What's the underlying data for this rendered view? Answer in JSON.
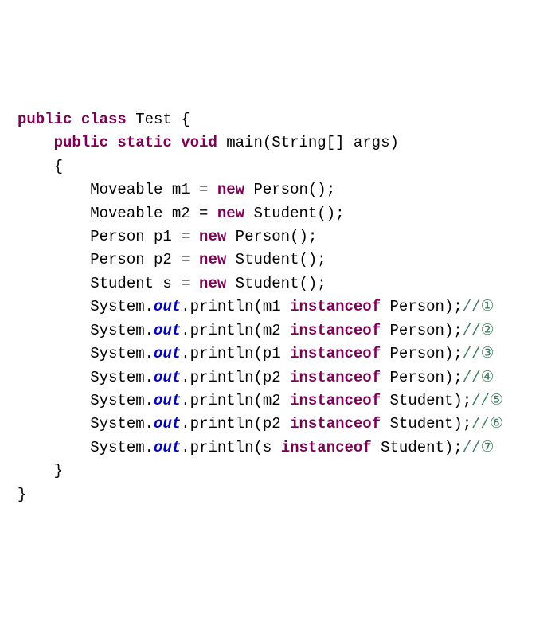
{
  "code": {
    "line1": {
      "kw1": "public class",
      "rest": " Test {"
    },
    "line2": {
      "indent": "    ",
      "kw1": "public static void",
      "rest": " main(String[] args)"
    },
    "line3": {
      "indent": "    ",
      "rest": "{"
    },
    "line4": {
      "indent": "        ",
      "part1": "Moveable m1 = ",
      "kw": "new",
      "part2": " Person();"
    },
    "line5": {
      "indent": "        ",
      "part1": "Moveable m2 = ",
      "kw": "new",
      "part2": " Student();"
    },
    "line6": {
      "indent": "        ",
      "part1": "Person p1 = ",
      "kw": "new",
      "part2": " Person();"
    },
    "line7": {
      "indent": "        ",
      "part1": "Person p2 = ",
      "kw": "new",
      "part2": " Student();"
    },
    "line8": {
      "indent": "        ",
      "part1": "Student s = ",
      "kw": "new",
      "part2": " Student();"
    },
    "line9": {
      "indent": "        ",
      "sys": "System.",
      "out": "out",
      "print": ".println(m1 ",
      "kw": "instanceof",
      "rest": " Person);",
      "comment": "//①"
    },
    "line10": {
      "indent": "        ",
      "sys": "System.",
      "out": "out",
      "print": ".println(m2 ",
      "kw": "instanceof",
      "rest": " Person);",
      "comment": "//②"
    },
    "line11": {
      "indent": "        ",
      "sys": "System.",
      "out": "out",
      "print": ".println(p1 ",
      "kw": "instanceof",
      "rest": " Person);",
      "comment": "//③"
    },
    "line12": {
      "indent": "        ",
      "sys": "System.",
      "out": "out",
      "print": ".println(p2 ",
      "kw": "instanceof",
      "rest": " Person);",
      "comment": "//④"
    },
    "line13": {
      "indent": "        ",
      "sys": "System.",
      "out": "out",
      "print": ".println(m2 ",
      "kw": "instanceof",
      "rest": " Student);",
      "comment": "//⑤"
    },
    "line14": {
      "indent": "        ",
      "sys": "System.",
      "out": "out",
      "print": ".println(p2 ",
      "kw": "instanceof",
      "rest": " Student);",
      "comment": "//⑥"
    },
    "line15": {
      "indent": "        ",
      "sys": "System.",
      "out": "out",
      "print": ".println(s ",
      "kw": "instanceof",
      "rest": " Student);",
      "comment": "//⑦"
    },
    "line16": {
      "indent": "    ",
      "rest": "}"
    },
    "line17": {
      "rest": "}"
    }
  }
}
